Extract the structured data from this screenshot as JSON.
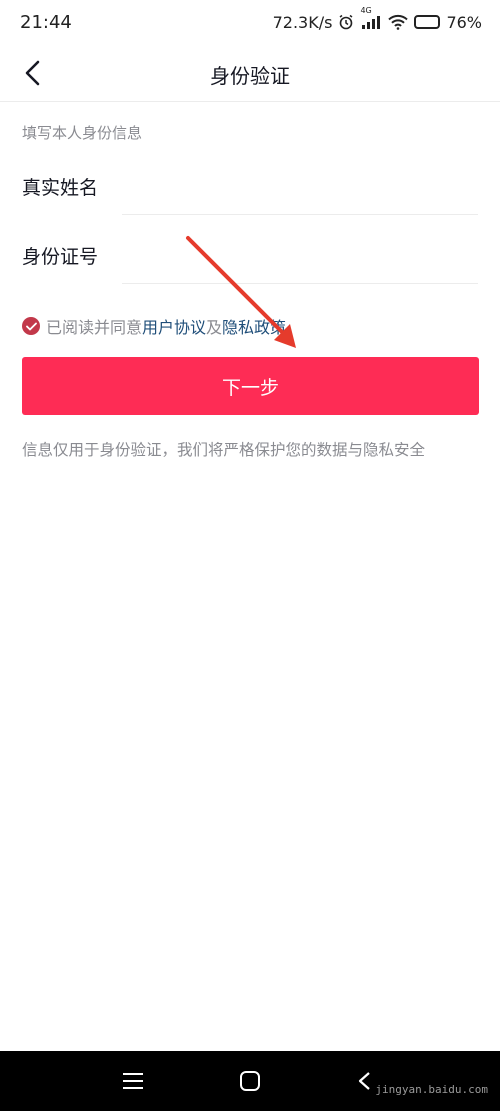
{
  "status_bar": {
    "time": "21:44",
    "network_speed": "72.3K/s",
    "network_type": "4G",
    "battery": "76",
    "battery_level": 0.76
  },
  "header": {
    "title": "身份验证"
  },
  "form": {
    "section_hint": "填写本人身份信息",
    "name_label": "真实姓名",
    "name_value": "",
    "id_label": "身份证号",
    "id_value": ""
  },
  "agreement": {
    "checked": true,
    "prefix": "已阅读并同意",
    "user_agreement": "用户协议",
    "conjunction": "及",
    "privacy_policy": "隐私政策"
  },
  "actions": {
    "next_label": "下一步"
  },
  "notice": {
    "text": "信息仅用于身份验证，我们将严格保护您的数据与隐私安全"
  },
  "icons": {
    "back": "chevron-left-icon",
    "check": "check-icon",
    "alarm": "alarm-icon",
    "signal": "signal-icon",
    "wifi": "wifi-icon",
    "battery": "battery-icon",
    "menu": "menu-icon",
    "home": "home-icon",
    "nav_back": "nav-back-icon"
  },
  "watermark": {
    "text": "jingyan.baidu.com"
  },
  "colors": {
    "primary_button": "#fe2c55",
    "checkbox": "#c2384a",
    "link": "#1f4e79",
    "annotation_arrow": "#e53b2c"
  }
}
